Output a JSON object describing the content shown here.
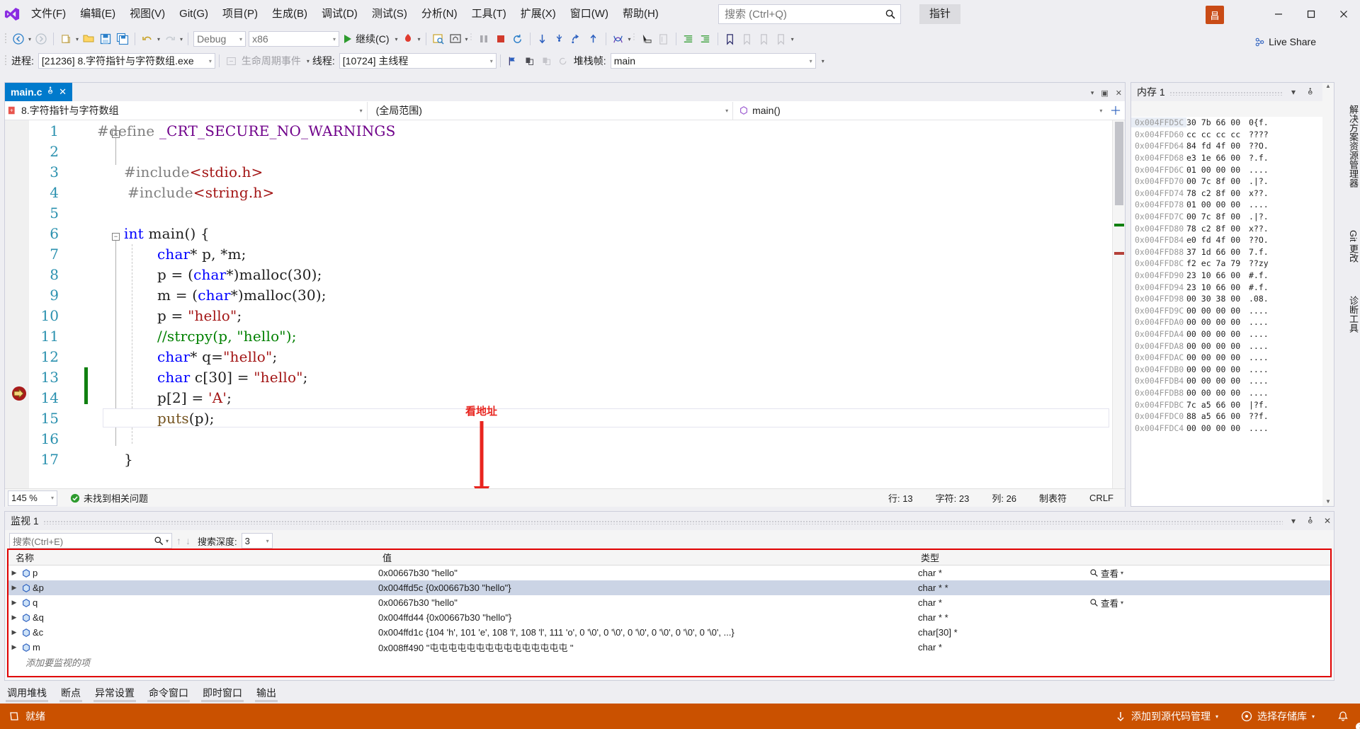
{
  "menu": {
    "items": [
      {
        "label": "文件(F)",
        "name": "menu-file"
      },
      {
        "label": "编辑(E)",
        "name": "menu-edit"
      },
      {
        "label": "视图(V)",
        "name": "menu-view"
      },
      {
        "label": "Git(G)",
        "name": "menu-git"
      },
      {
        "label": "项目(P)",
        "name": "menu-project"
      },
      {
        "label": "生成(B)",
        "name": "menu-build"
      },
      {
        "label": "调试(D)",
        "name": "menu-debug"
      },
      {
        "label": "测试(S)",
        "name": "menu-test"
      },
      {
        "label": "分析(N)",
        "name": "menu-analyze"
      },
      {
        "label": "工具(T)",
        "name": "menu-tools"
      },
      {
        "label": "扩展(X)",
        "name": "menu-extensions"
      },
      {
        "label": "窗口(W)",
        "name": "menu-window"
      },
      {
        "label": "帮助(H)",
        "name": "menu-help"
      }
    ]
  },
  "search": {
    "placeholder": "搜索 (Ctrl+Q)",
    "value": ""
  },
  "pin_tab": "指针",
  "user_initial": "昌",
  "live_share": "Live Share",
  "toolbar": {
    "config": "Debug",
    "platform": "x86",
    "run_label": "继续(C)"
  },
  "debugbar": {
    "process_label": "进程:",
    "process_value": "[21236] 8.字符指针与字符数组.exe",
    "lifecycle_label": "生命周期事件",
    "thread_label": "线程:",
    "thread_value": "[10724] 主线程",
    "stackframe_label": "堆栈帧:",
    "stackframe_value": "main"
  },
  "editor": {
    "tab_name": "main.c",
    "project_scope": "8.字符指针与字符数组",
    "global_scope": "(全局范围)",
    "function_scope": "main()",
    "annotation": "看地址",
    "lines": [
      {
        "n": "1",
        "tokens": [
          {
            "t": "#define ",
            "c": "k-pp"
          },
          {
            "t": "_CRT_SECURE_NO_WARNINGS",
            "c": "k-mac"
          }
        ]
      },
      {
        "n": "2",
        "tokens": []
      },
      {
        "n": "3",
        "tokens": [
          {
            "t": "#include",
            "c": "k-pp"
          },
          {
            "t": "<stdio.h>",
            "c": "k-inc"
          }
        ]
      },
      {
        "n": "4",
        "tokens": [
          {
            "t": "#include",
            "c": "k-pp"
          },
          {
            "t": "<string.h>",
            "c": "k-inc"
          }
        ]
      },
      {
        "n": "5",
        "tokens": []
      },
      {
        "n": "6",
        "tokens": [
          {
            "t": "int ",
            "c": "k-kw"
          },
          {
            "t": "main",
            "c": "k-def"
          },
          {
            "t": "() {",
            "c": "k-def"
          }
        ]
      },
      {
        "n": "7",
        "tokens": [
          {
            "t": "    ",
            "c": "k-def"
          },
          {
            "t": "char",
            "c": "k-kw"
          },
          {
            "t": "* p, *m;",
            "c": "k-def"
          }
        ]
      },
      {
        "n": "8",
        "tokens": [
          {
            "t": "    p = (",
            "c": "k-def"
          },
          {
            "t": "char",
            "c": "k-kw"
          },
          {
            "t": "*)malloc(30);",
            "c": "k-def"
          }
        ]
      },
      {
        "n": "9",
        "tokens": [
          {
            "t": "    m = (",
            "c": "k-def"
          },
          {
            "t": "char",
            "c": "k-kw"
          },
          {
            "t": "*)malloc(30);",
            "c": "k-def"
          }
        ]
      },
      {
        "n": "10",
        "tokens": [
          {
            "t": "    p = ",
            "c": "k-def"
          },
          {
            "t": "\"hello\"",
            "c": "k-str"
          },
          {
            "t": ";",
            "c": "k-def"
          }
        ]
      },
      {
        "n": "11",
        "tokens": [
          {
            "t": "    //strcpy(p, \"hello\");",
            "c": "k-cmt"
          }
        ]
      },
      {
        "n": "12",
        "tokens": [
          {
            "t": "    ",
            "c": "k-def"
          },
          {
            "t": "char",
            "c": "k-kw"
          },
          {
            "t": "* q=",
            "c": "k-def"
          },
          {
            "t": "\"hello\"",
            "c": "k-str"
          },
          {
            "t": ";",
            "c": "k-def"
          }
        ]
      },
      {
        "n": "13",
        "tokens": [
          {
            "t": "    ",
            "c": "k-def"
          },
          {
            "t": "char",
            "c": "k-kw"
          },
          {
            "t": " c[30] = ",
            "c": "k-def"
          },
          {
            "t": "\"hello\"",
            "c": "k-str"
          },
          {
            "t": ";",
            "c": "k-def"
          }
        ]
      },
      {
        "n": "14",
        "tokens": [
          {
            "t": "    p[2] = ",
            "c": "k-def"
          },
          {
            "t": "'A'",
            "c": "k-str"
          },
          {
            "t": ";",
            "c": "k-def"
          }
        ]
      },
      {
        "n": "15",
        "tokens": [
          {
            "t": "    ",
            "c": "k-def"
          },
          {
            "t": "puts",
            "c": "k-fn"
          },
          {
            "t": "(p);",
            "c": "k-def"
          }
        ]
      },
      {
        "n": "16",
        "tokens": []
      },
      {
        "n": "17",
        "tokens": [
          {
            "t": "}",
            "c": "k-def"
          }
        ]
      }
    ],
    "status": {
      "zoom": "145 %",
      "problems": "未找到相关问题",
      "line": "行: 13",
      "chars": "字符: 23",
      "col": "列: 26",
      "tabs": "制表符",
      "eol": "CRLF"
    }
  },
  "memory": {
    "title": "内存 1",
    "rows": [
      {
        "addr": "0x004FFD5C",
        "hex": "30 7b 66 00",
        "ascii": "0{f.",
        "sel": true
      },
      {
        "addr": "0x004FFD60",
        "hex": "cc cc cc cc",
        "ascii": "????",
        "sel": false
      },
      {
        "addr": "0x004FFD64",
        "hex": "84 fd 4f 00",
        "ascii": "??O.",
        "sel": false
      },
      {
        "addr": "0x004FFD68",
        "hex": "e3 1e 66 00",
        "ascii": "?.f.",
        "sel": false
      },
      {
        "addr": "0x004FFD6C",
        "hex": "01 00 00 00",
        "ascii": "....",
        "sel": false
      },
      {
        "addr": "0x004FFD70",
        "hex": "00 7c 8f 00",
        "ascii": ".|?.",
        "sel": false
      },
      {
        "addr": "0x004FFD74",
        "hex": "78 c2 8f 00",
        "ascii": "x??.",
        "sel": false
      },
      {
        "addr": "0x004FFD78",
        "hex": "01 00 00 00",
        "ascii": "....",
        "sel": false
      },
      {
        "addr": "0x004FFD7C",
        "hex": "00 7c 8f 00",
        "ascii": ".|?.",
        "sel": false
      },
      {
        "addr": "0x004FFD80",
        "hex": "78 c2 8f 00",
        "ascii": "x??.",
        "sel": false
      },
      {
        "addr": "0x004FFD84",
        "hex": "e0 fd 4f 00",
        "ascii": "??O.",
        "sel": false
      },
      {
        "addr": "0x004FFD88",
        "hex": "37 1d 66 00",
        "ascii": "7.f.",
        "sel": false
      },
      {
        "addr": "0x004FFD8C",
        "hex": "f2 ec 7a 79",
        "ascii": "??zy",
        "sel": false
      },
      {
        "addr": "0x004FFD90",
        "hex": "23 10 66 00",
        "ascii": "#.f.",
        "sel": false
      },
      {
        "addr": "0x004FFD94",
        "hex": "23 10 66 00",
        "ascii": "#.f.",
        "sel": false
      },
      {
        "addr": "0x004FFD98",
        "hex": "00 30 38 00",
        "ascii": ".08.",
        "sel": false
      },
      {
        "addr": "0x004FFD9C",
        "hex": "00 00 00 00",
        "ascii": "....",
        "sel": false
      },
      {
        "addr": "0x004FFDA0",
        "hex": "00 00 00 00",
        "ascii": "....",
        "sel": false
      },
      {
        "addr": "0x004FFDA4",
        "hex": "00 00 00 00",
        "ascii": "....",
        "sel": false
      },
      {
        "addr": "0x004FFDA8",
        "hex": "00 00 00 00",
        "ascii": "....",
        "sel": false
      },
      {
        "addr": "0x004FFDAC",
        "hex": "00 00 00 00",
        "ascii": "....",
        "sel": false
      },
      {
        "addr": "0x004FFDB0",
        "hex": "00 00 00 00",
        "ascii": "....",
        "sel": false
      },
      {
        "addr": "0x004FFDB4",
        "hex": "00 00 00 00",
        "ascii": "....",
        "sel": false
      },
      {
        "addr": "0x004FFDB8",
        "hex": "00 00 00 00",
        "ascii": "....",
        "sel": false
      },
      {
        "addr": "0x004FFDBC",
        "hex": "7c a5 66 00",
        "ascii": "|?f.",
        "sel": false
      },
      {
        "addr": "0x004FFDC0",
        "hex": "88 a5 66 00",
        "ascii": "??f.",
        "sel": false
      },
      {
        "addr": "0x004FFDC4",
        "hex": "00 00 00 00",
        "ascii": "....",
        "sel": false
      }
    ]
  },
  "vtabs": [
    {
      "label": "解决方案资源管理器",
      "name": "vtab-solution-explorer"
    },
    {
      "label": "Git 更改",
      "name": "vtab-git-changes"
    },
    {
      "label": "诊断工具",
      "name": "vtab-diagnostic-tools"
    }
  ],
  "watch": {
    "title": "监视 1",
    "search_placeholder": "搜索(Ctrl+E)",
    "depth_label": "搜索深度:",
    "depth_value": "3",
    "view_label": "查看",
    "add_item": "添加要监视的项",
    "headers": {
      "name": "名称",
      "value": "值",
      "type": "类型"
    },
    "rows": [
      {
        "name": "p",
        "value": "0x00667b30 \"hello\"",
        "type": "char *",
        "selected": false,
        "magnifier": true
      },
      {
        "name": "&p",
        "value": "0x004ffd5c {0x00667b30 \"hello\"}",
        "type": "char * *",
        "selected": true,
        "magnifier": false
      },
      {
        "name": "q",
        "value": "0x00667b30 \"hello\"",
        "type": "char *",
        "selected": false,
        "magnifier": true
      },
      {
        "name": "&q",
        "value": "0x004ffd44 {0x00667b30 \"hello\"}",
        "type": "char * *",
        "selected": false,
        "magnifier": false
      },
      {
        "name": "&c",
        "value": "0x004ffd1c {104 'h', 101 'e', 108 'l', 108 'l', 111 'o', 0 '\\0', 0 '\\0', 0 '\\0', 0 '\\0', 0 '\\0', 0 '\\0', ...}",
        "type": "char[30] *",
        "selected": false,
        "magnifier": false
      },
      {
        "name": "m",
        "value": "0x008ff490 \"屯屯屯屯屯屯屯屯屯屯屯屯屯屯屯     \"",
        "type": "char *",
        "selected": false,
        "magnifier": false
      }
    ]
  },
  "bottom_tabs": [
    {
      "label": "调用堆栈",
      "name": "tab-call-stack"
    },
    {
      "label": "断点",
      "name": "tab-breakpoints"
    },
    {
      "label": "异常设置",
      "name": "tab-exception-settings"
    },
    {
      "label": "命令窗口",
      "name": "tab-command-window"
    },
    {
      "label": "即时窗口",
      "name": "tab-immediate-window"
    },
    {
      "label": "输出",
      "name": "tab-output"
    }
  ],
  "statusbar": {
    "ready": "就绪",
    "source_control": "添加到源代码管理",
    "repo": "选择存储库",
    "notifications": "1"
  },
  "colors": {
    "accent_blue": "#007acc",
    "status_orange": "#ca5100",
    "annotation_red": "#e8251f",
    "changebar_green": "#108010"
  }
}
